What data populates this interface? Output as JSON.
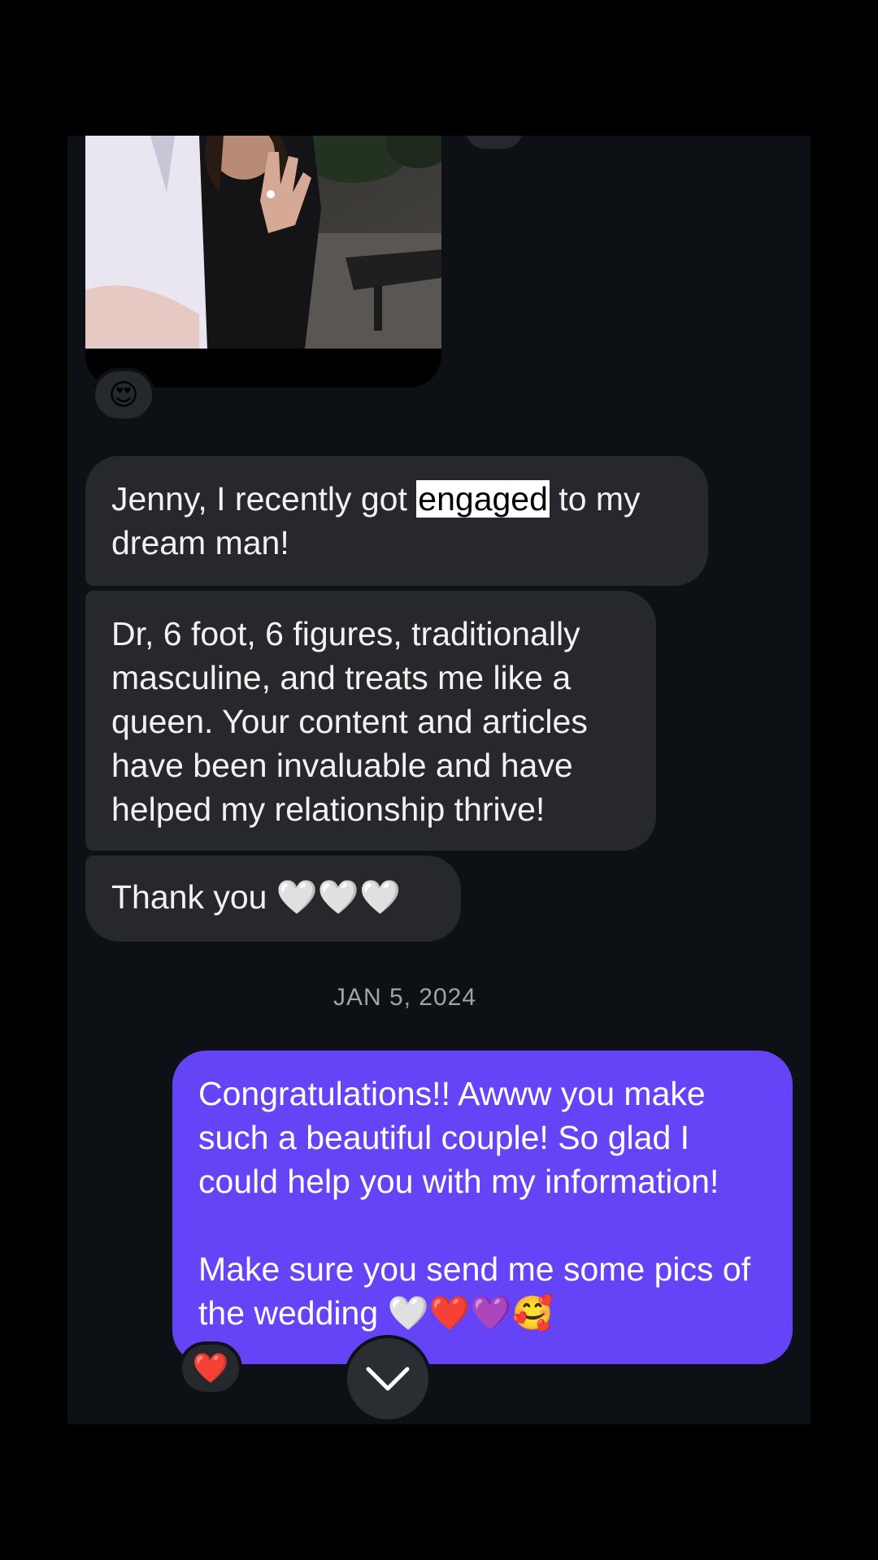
{
  "thread": {
    "photo_reaction": "😍",
    "messages_in": [
      {
        "before": "Jenny, I recently got ",
        "highlight": "engaged",
        "after": " to my dream man!"
      },
      {
        "text": "Dr, 6 foot, 6 figures, traditionally masculine, and treats me like a queen. Your content and articles have been invaluable and have helped my relationship thrive!"
      },
      {
        "text": "Thank you 🤍🤍🤍"
      }
    ],
    "date_divider": "JAN 5, 2024",
    "message_out": {
      "line1": "Congratulations!! Awww you make such a beautiful couple! So glad I could help you with my information!",
      "line2": "Make sure you send me some pics of the wedding 🤍❤️💜🥰"
    },
    "out_reaction": "❤️",
    "scroll_down_icon": "chevron-down-icon"
  }
}
